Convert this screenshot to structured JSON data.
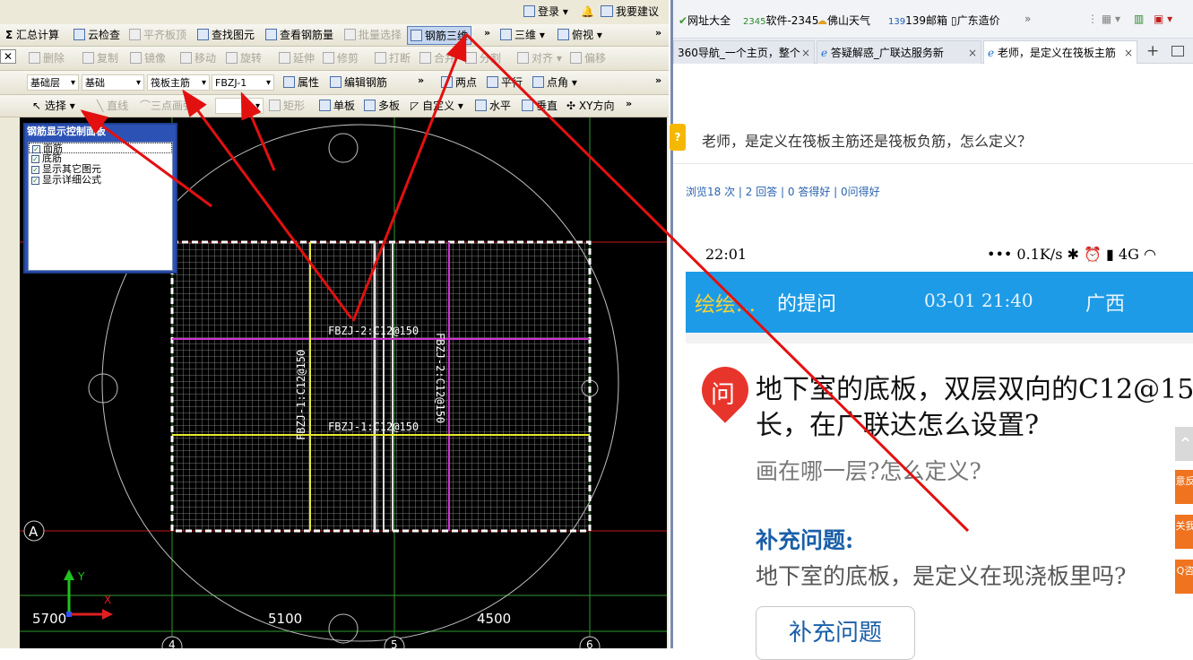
{
  "app": {
    "top_right": {
      "login": "登录",
      "suggest": "我要建议"
    },
    "toolbar1": [
      "汇总计算",
      "云检查",
      "平齐板顶",
      "查找图元",
      "查看钢筋量",
      "批量选择",
      "钢筋三维",
      "三维",
      "俯视"
    ],
    "toolbar2": [
      "删除",
      "复制",
      "镜像",
      "移动",
      "旋转",
      "延伸",
      "修剪",
      "打断",
      "合并",
      "分割",
      "对齐",
      "偏移"
    ],
    "toolbar3": {
      "layer": "基础层",
      "type": "基础",
      "category": "筏板主筋",
      "element": "FBZJ-1",
      "props": "属性",
      "edit_rebar": "编辑钢筋",
      "two_points": "两点",
      "parallel": "平行",
      "point_angle": "点角"
    },
    "toolbar4": [
      "选择",
      "直线",
      "三点画弧",
      "矩形",
      "单板",
      "多板",
      "自定义",
      "水平",
      "垂直",
      "XY方向"
    ],
    "panel": {
      "title": "钢筋显示控制面板",
      "items": [
        "面筋",
        "底筋",
        "显示其它图元",
        "显示详细公式"
      ]
    },
    "canvas": {
      "labels": [
        "FBZJ-2:C12@150",
        "FBZJ-1:C12@150",
        "FBZJ-1:C12@150",
        "FBZJ-2:C12@150"
      ],
      "axis_a": "A",
      "dims": [
        "5700",
        "5100",
        "4500"
      ],
      "axes": [
        "4",
        "5",
        "6"
      ],
      "ucs_x": "X",
      "ucs_y": "Y"
    }
  },
  "browser": {
    "bookmarks": [
      "网址大全",
      "软件-2345",
      "佛山天气",
      "139邮箱",
      "广东造价"
    ],
    "tabs": [
      "360导航_一个主页，整个",
      "答疑解惑_广联达服务新",
      "老师，是定义在筏板主筋"
    ],
    "question": "老师，是定义在筏板主筋还是筏板负筋，怎么定义？",
    "stats": "浏览18 次 | 2 回答 | 0 答得好 | 0问得好",
    "phone": {
      "time": "22:01",
      "status": "0.1K/s",
      "net": "4G",
      "asker": "绘绘...",
      "asker_suffix": "的提问",
      "date": "03-01 21:40",
      "region": "广西",
      "q_badge": "问",
      "q_line1": "地下室的底板，双层双向的C12@15",
      "q_line2": "长，在广联达怎么设置?",
      "q_line3": "画在哪一层?怎么定义?",
      "supp_title": "补充问题:",
      "supp_text": "地下室的底板，是定义在现浇板里吗?",
      "supp_button": "补充问题",
      "side": [
        "意反",
        "关我",
        "Q咨"
      ]
    }
  },
  "colors": {
    "accent": "#1e9be6",
    "arrow": "#e31010",
    "panel": "#2c52b5"
  }
}
